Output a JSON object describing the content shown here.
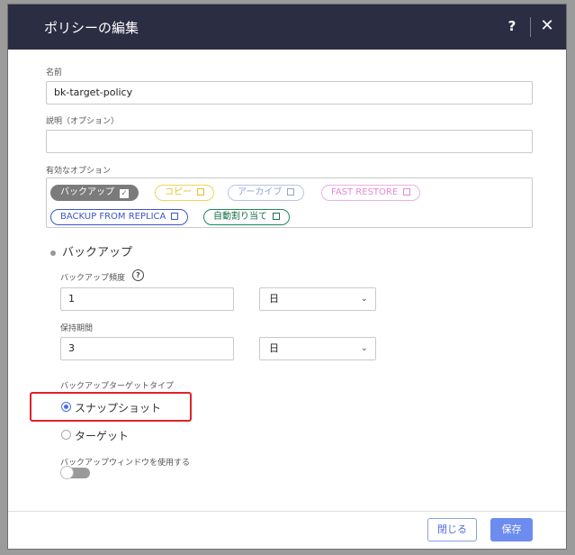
{
  "dialog": {
    "title": "ポリシーの編集",
    "help_label": "?",
    "close_label": "✕"
  },
  "fields": {
    "name_label": "名前",
    "name_value": "bk-target-policy",
    "description_label": "説明（オプション）",
    "description_value": "",
    "options_label": "有効なオプション"
  },
  "options": [
    {
      "label": "バックアップ",
      "checked": true,
      "color": "#7b7b7b"
    },
    {
      "label": "コピー",
      "checked": false,
      "color": "#f0d45a"
    },
    {
      "label": "アーカイブ",
      "checked": false,
      "color": "#9fb3e0"
    },
    {
      "label": "FAST RESTORE",
      "checked": false,
      "color": "#e89ad8"
    },
    {
      "label": "BACKUP FROM REPLICA",
      "checked": false,
      "color": "#3c55c8"
    },
    {
      "label": "自動割り当て",
      "checked": false,
      "color": "#1b8a5a"
    }
  ],
  "backup": {
    "section_title": "バックアップ",
    "frequency_label": "バックアップ頻度",
    "frequency_help": "?",
    "frequency_value": "1",
    "frequency_unit": "日",
    "retention_label": "保持期間",
    "retention_value": "3",
    "retention_unit": "日",
    "target_type_label": "バックアップターゲットタイプ",
    "target_options": [
      {
        "label": "スナップショット",
        "selected": true
      },
      {
        "label": "ターゲット",
        "selected": false
      }
    ],
    "window_label": "バックアップウィンドウを使用する",
    "window_enabled": false
  },
  "footer": {
    "close_button": "閉じる",
    "save_button": "保存"
  },
  "colors": {
    "titlebar": "#2b2d42",
    "accent": "#6d8cf0",
    "highlight": "#e0222a"
  }
}
